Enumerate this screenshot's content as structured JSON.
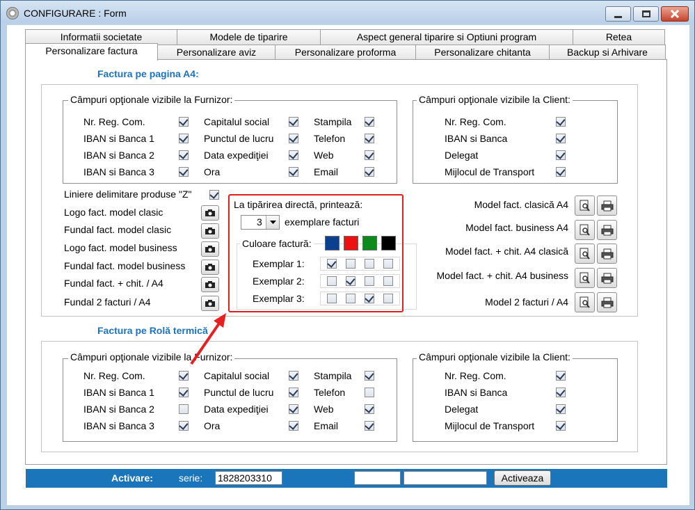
{
  "window": {
    "title": "CONFIGURARE : Form"
  },
  "tabs_row1": [
    {
      "label": "Informatii societate"
    },
    {
      "label": "Modele de tiparire"
    },
    {
      "label": "Aspect general tiparire si Optiuni program"
    },
    {
      "label": "Retea"
    }
  ],
  "tabs_row2": [
    {
      "label": "Personalizare factura",
      "active": true
    },
    {
      "label": "Personalizare aviz"
    },
    {
      "label": "Personalizare proforma"
    },
    {
      "label": "Personalizare chitanta"
    },
    {
      "label": "Backup si Arhivare"
    }
  ],
  "a4": {
    "title": "Factura pe pagina A4:",
    "furnizor": {
      "legend": "Câmpuri opţionale vizibile la Furnizor:",
      "items": [
        {
          "label": "Nr. Reg. Com.",
          "checked": true
        },
        {
          "label": "IBAN si Banca 1",
          "checked": true
        },
        {
          "label": "IBAN si Banca 2",
          "checked": true
        },
        {
          "label": "IBAN si Banca 3",
          "checked": true
        },
        {
          "label": "Capitalul social",
          "checked": true
        },
        {
          "label": "Punctul de lucru",
          "checked": true
        },
        {
          "label": "Data expediţiei",
          "checked": true
        },
        {
          "label": "Ora",
          "checked": true
        },
        {
          "label": "Stampila",
          "checked": true
        },
        {
          "label": "Telefon",
          "checked": true
        },
        {
          "label": "Web",
          "checked": true
        },
        {
          "label": "Email",
          "checked": true
        }
      ]
    },
    "client": {
      "legend": "Câmpuri opţionale vizibile la Client:",
      "items": [
        {
          "label": "Nr. Reg. Com.",
          "checked": true
        },
        {
          "label": "IBAN si Banca",
          "checked": true
        },
        {
          "label": "Delegat",
          "checked": true
        },
        {
          "label": "Mijlocul de Transport",
          "checked": true
        }
      ]
    },
    "liniere": {
      "label": "Liniere delimitare produse \"Z\"",
      "checked": true
    },
    "images": [
      {
        "label": "Logo fact. model clasic"
      },
      {
        "label": "Fundal fact. model clasic"
      },
      {
        "label": "Logo fact. model business"
      },
      {
        "label": "Fundal fact. model business"
      },
      {
        "label": "Fundal fact. + chit. / A4"
      },
      {
        "label": "Fundal 2 facturi / A4"
      }
    ],
    "print": {
      "label": "La tipărirea directă, printează:",
      "copies": "3",
      "copies_suffix": "exemplare facturi",
      "color_legend": "Culoare factură:",
      "colors": [
        "#0b3f8f",
        "#ee1111",
        "#0d8a1c",
        "#000000"
      ],
      "exemplars": [
        {
          "label": "Exemplar 1:",
          "checks": [
            true,
            false,
            false,
            false
          ]
        },
        {
          "label": "Exemplar 2:",
          "checks": [
            false,
            true,
            false,
            false
          ]
        },
        {
          "label": "Exemplar 3:",
          "checks": [
            false,
            false,
            true,
            false
          ]
        }
      ]
    },
    "models": [
      {
        "label": "Model fact. clasică A4"
      },
      {
        "label": "Model fact. business A4"
      },
      {
        "label": "Model fact. + chit. A4 clasică"
      },
      {
        "label": "Model fact. + chit. A4 business"
      },
      {
        "label": "Model 2 facturi / A4"
      }
    ]
  },
  "rola": {
    "title": "Factura pe Rolă termică",
    "furnizor": {
      "legend": "Câmpuri opţionale vizibile la Furnizor:",
      "items": [
        {
          "label": "Nr. Reg. Com.",
          "checked": true
        },
        {
          "label": "IBAN si Banca 1",
          "checked": true
        },
        {
          "label": "IBAN si Banca 2",
          "checked": false
        },
        {
          "label": "IBAN si Banca 3",
          "checked": true
        },
        {
          "label": "Capitalul social",
          "checked": true
        },
        {
          "label": "Punctul de lucru",
          "checked": true
        },
        {
          "label": "Data expediţiei",
          "checked": true
        },
        {
          "label": "Ora",
          "checked": true
        },
        {
          "label": "Stampila",
          "checked": true
        },
        {
          "label": "Telefon",
          "checked": false
        },
        {
          "label": "Web",
          "checked": true
        },
        {
          "label": "Email",
          "checked": true
        }
      ]
    },
    "client": {
      "legend": "Câmpuri opţionale vizibile la Client:",
      "items": [
        {
          "label": "Nr. Reg. Com.",
          "checked": true
        },
        {
          "label": "IBAN si Banca",
          "checked": true
        },
        {
          "label": "Delegat",
          "checked": true
        },
        {
          "label": "Mijlocul de Transport",
          "checked": true
        }
      ]
    }
  },
  "status": {
    "activare_label": "Activare:",
    "serie_label": "serie:",
    "serie_value": "1828203310",
    "field2": "",
    "field3": "",
    "button": "Activeaza"
  },
  "colors": {
    "accent": "#1f72b8",
    "statusbar": "#1b75bb",
    "highlight": "#e02020"
  }
}
